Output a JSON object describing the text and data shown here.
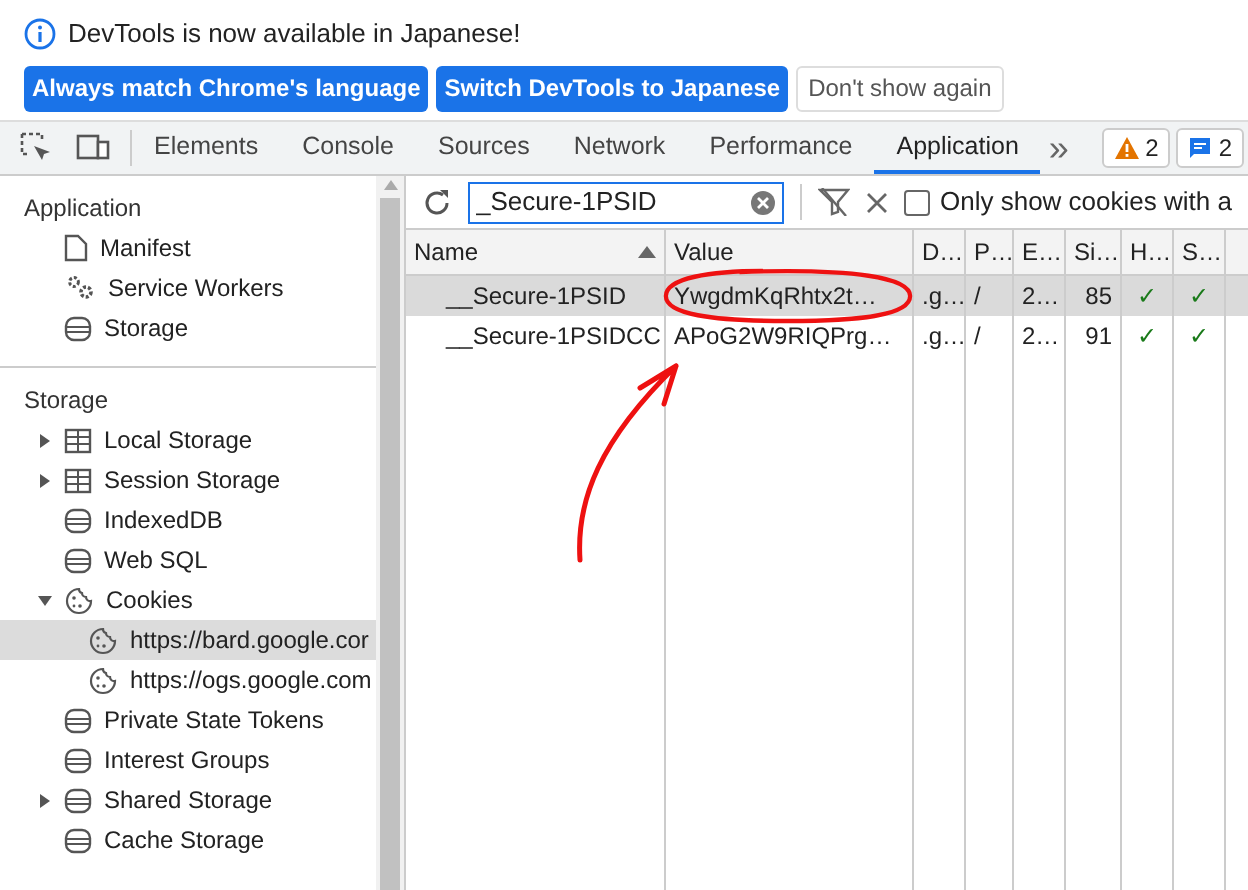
{
  "banner": {
    "message": "DevTools is now available in Japanese!",
    "buttons": [
      {
        "label": "Always match Chrome's language",
        "kind": "primary"
      },
      {
        "label": "Switch DevTools to Japanese",
        "kind": "primary"
      },
      {
        "label": "Don't show again",
        "kind": "secondary"
      }
    ]
  },
  "tabs": [
    {
      "label": "Elements",
      "selected": false
    },
    {
      "label": "Console",
      "selected": false
    },
    {
      "label": "Sources",
      "selected": false
    },
    {
      "label": "Network",
      "selected": false
    },
    {
      "label": "Performance",
      "selected": false
    },
    {
      "label": "Application",
      "selected": true
    }
  ],
  "more_tabs": "»",
  "badges": [
    {
      "kind": "warning",
      "count": "2"
    },
    {
      "kind": "message",
      "count": "2"
    }
  ],
  "sidebar": {
    "sections": [
      {
        "title": "Application",
        "items": [
          {
            "label": "Manifest",
            "kind": "file",
            "selected": false
          },
          {
            "label": "Service Workers",
            "kind": "gears",
            "selected": false
          },
          {
            "label": "Storage",
            "kind": "database",
            "selected": false
          }
        ]
      },
      {
        "title": "Storage",
        "items": [
          {
            "label": "Local Storage",
            "kind": "grid",
            "expanded": false,
            "selected": false
          },
          {
            "label": "Session Storage",
            "kind": "grid",
            "expanded": false,
            "selected": false
          },
          {
            "label": "IndexedDB",
            "kind": "database",
            "selected": false
          },
          {
            "label": "Web SQL",
            "kind": "database",
            "selected": false
          },
          {
            "label": "Cookies",
            "kind": "cookie",
            "expanded": true,
            "selected": false,
            "children": [
              {
                "label": "https://bard.google.cor",
                "kind": "cookie",
                "selected": true
              },
              {
                "label": "https://ogs.google.com",
                "kind": "cookie",
                "selected": false
              }
            ]
          },
          {
            "label": "Private State Tokens",
            "kind": "database",
            "selected": false
          },
          {
            "label": "Interest Groups",
            "kind": "database",
            "selected": false
          },
          {
            "label": "Shared Storage",
            "kind": "database",
            "expanded": false,
            "selected": false
          },
          {
            "label": "Cache Storage",
            "kind": "database",
            "selected": false
          }
        ]
      }
    ]
  },
  "toolbar": {
    "filter": {
      "value": "_Secure-1PSID"
    },
    "only_show_issues": {
      "label": "Only show cookies with a",
      "checked": false
    }
  },
  "table": {
    "columns": [
      "Name",
      "Value",
      "D…",
      "P…",
      "E…",
      "Si…",
      "H…",
      "S…"
    ],
    "rows": [
      {
        "cells": [
          "__Secure-1PSID",
          "YwgdmKqRhtx2t…",
          ".g…",
          "/",
          "2…",
          "85",
          "✓",
          "✓"
        ],
        "selected": true
      },
      {
        "cells": [
          "__Secure-1PSIDCC",
          "APoG2W9RIQPrg…",
          ".g…",
          "/",
          "2…",
          "91",
          "✓",
          "✓"
        ],
        "selected": false
      }
    ]
  }
}
